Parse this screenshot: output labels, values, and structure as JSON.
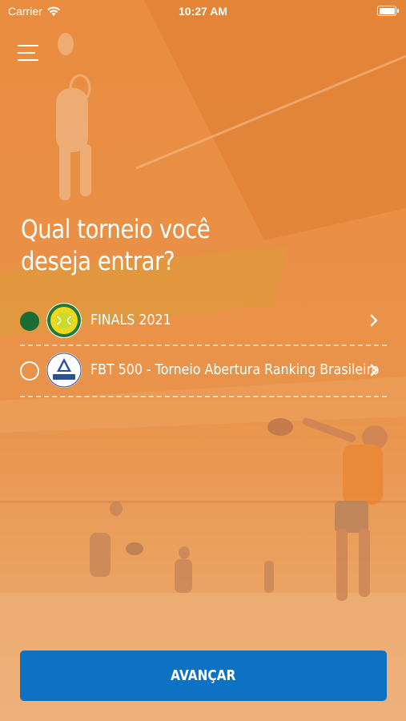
{
  "status_bar": {
    "carrier": "Carrier",
    "time": "10:27 AM"
  },
  "header": {
    "menu_icon": "hamburger-menu-icon"
  },
  "question": {
    "line1": "Qual torneio você",
    "line2": "deseja entrar?"
  },
  "tournaments": [
    {
      "label": "FINALS 2021",
      "selected": true,
      "logo": "tennis-ball-club-logo"
    },
    {
      "label": "FBT 500 - Torneio Abertura Ranking Brasileiro",
      "selected": false,
      "logo": "federacao-logo"
    }
  ],
  "footer": {
    "advance_label": "AVANÇAR"
  },
  "colors": {
    "background": "#e8944d",
    "button": "#0e72c4",
    "selected_radio": "#1a6d32"
  }
}
